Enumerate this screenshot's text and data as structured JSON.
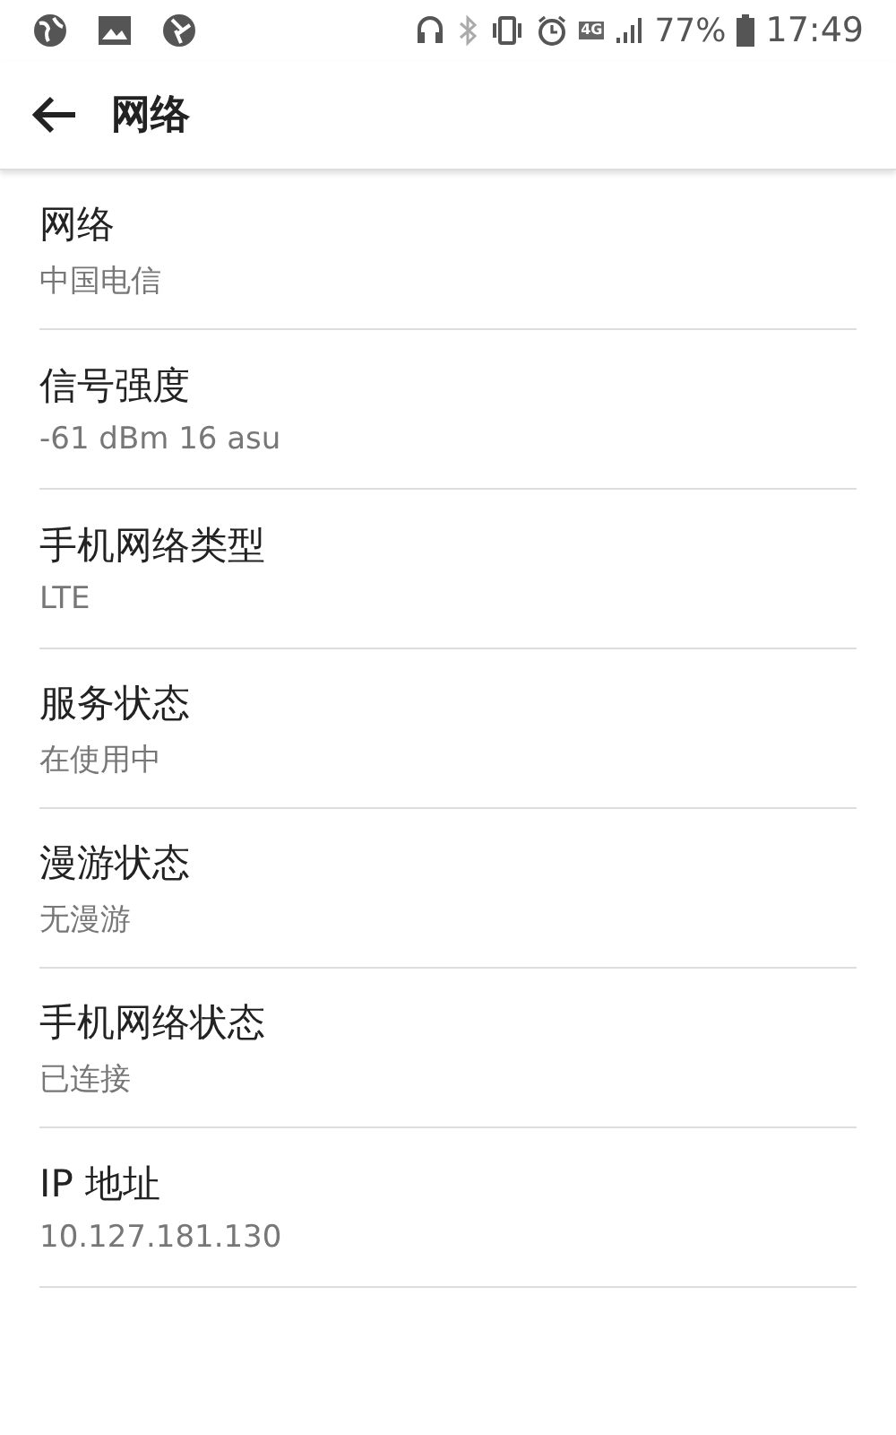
{
  "status_bar": {
    "network_badge": "4G",
    "battery": "77%",
    "time": "17:49"
  },
  "header": {
    "title": "网络"
  },
  "items": [
    {
      "title": "网络",
      "value": "中国电信"
    },
    {
      "title": "信号强度",
      "value": "-61 dBm 16 asu"
    },
    {
      "title": "手机网络类型",
      "value": "LTE"
    },
    {
      "title": "服务状态",
      "value": "在使用中"
    },
    {
      "title": "漫游状态",
      "value": "无漫游"
    },
    {
      "title": "手机网络状态",
      "value": "已连接"
    },
    {
      "title": "IP 地址",
      "value": "10.127.181.130"
    }
  ]
}
